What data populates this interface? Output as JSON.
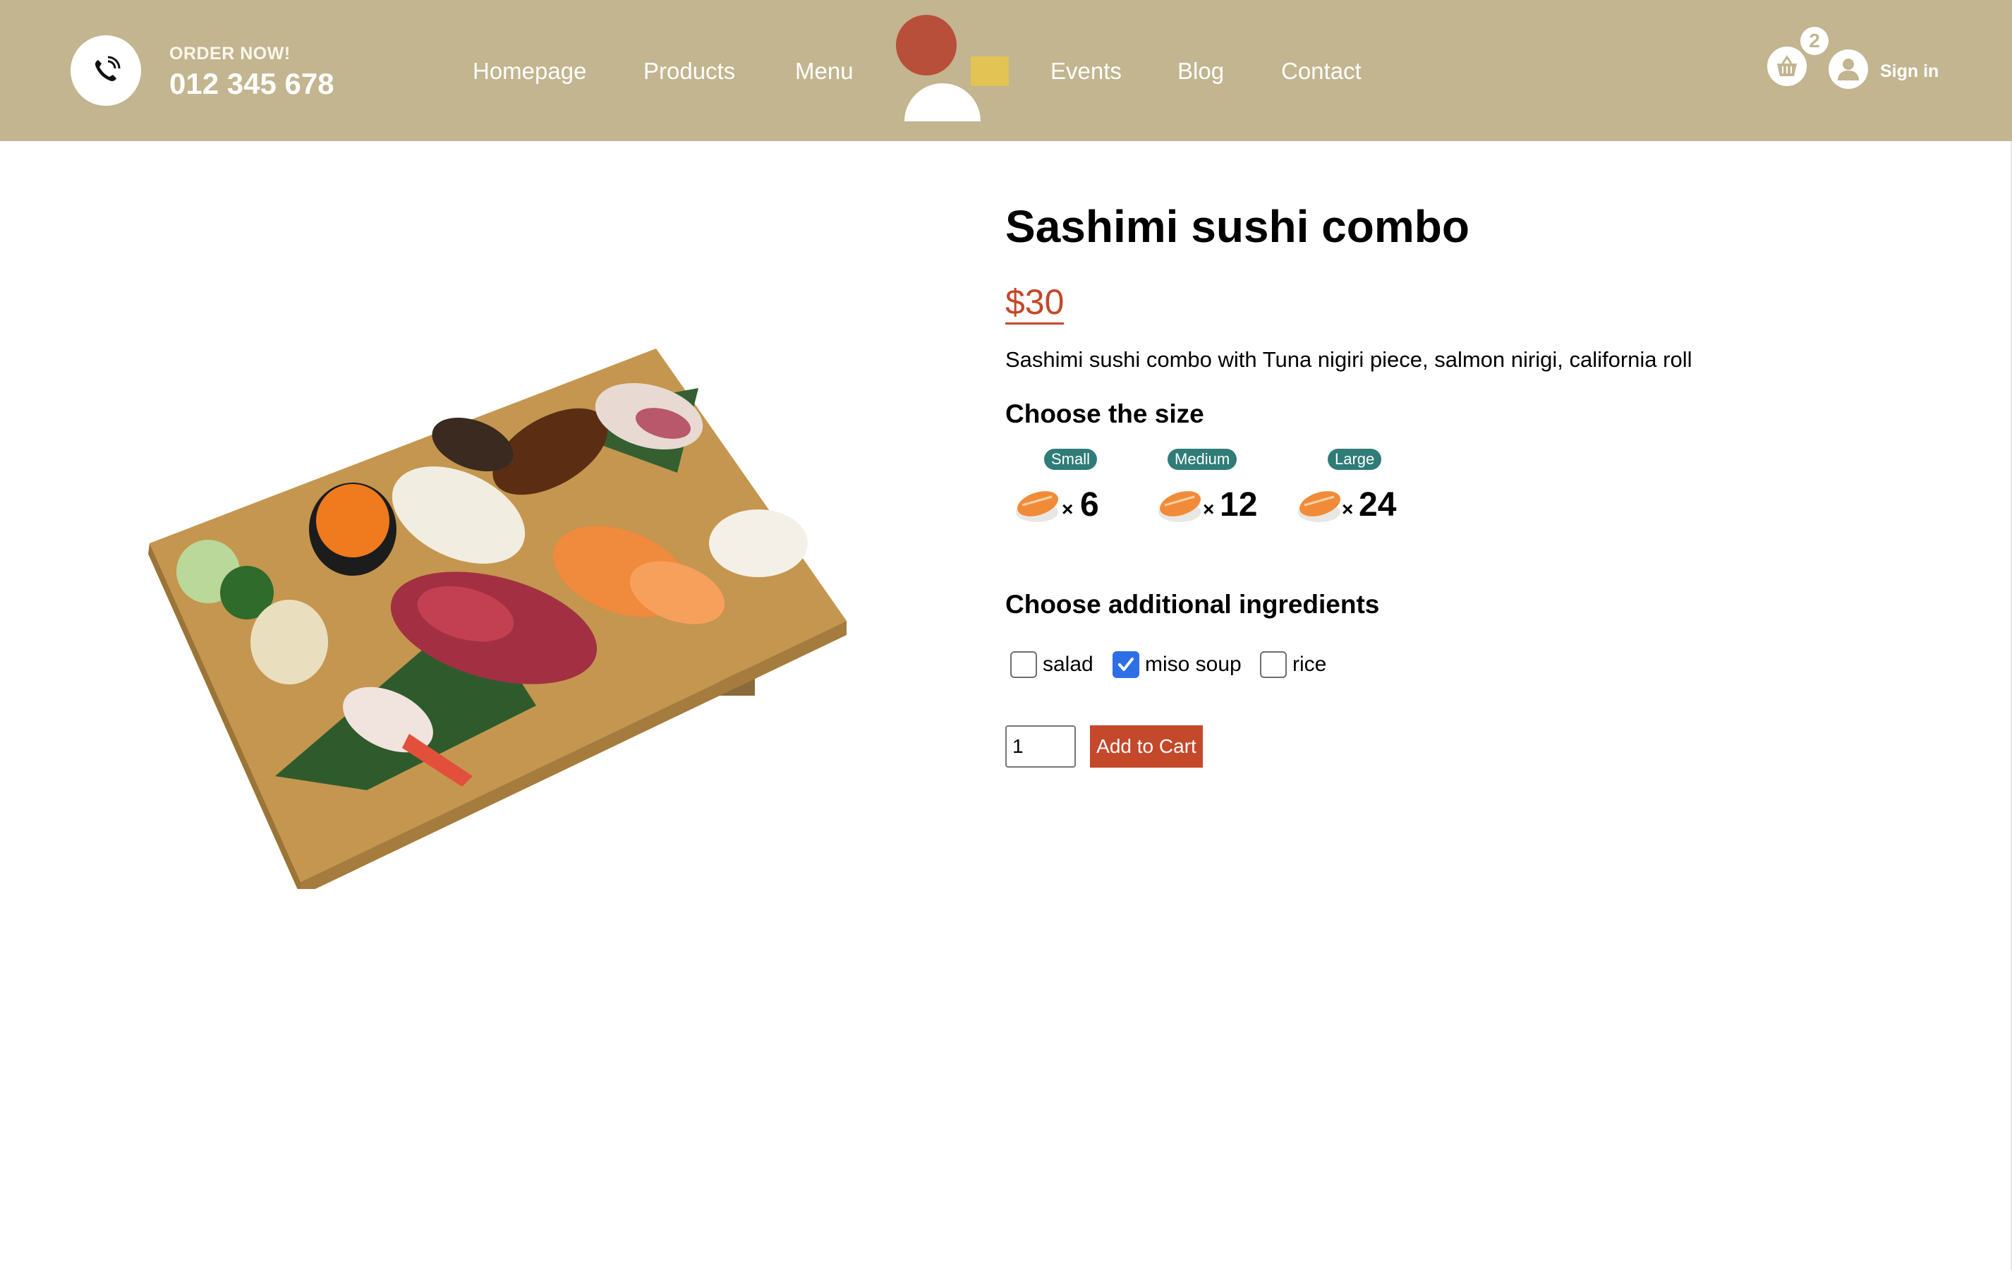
{
  "header": {
    "order_label": "ORDER NOW!",
    "phone": "012 345 678",
    "nav": [
      "Homepage",
      "Products",
      "Menu",
      "Events",
      "Blog",
      "Contact"
    ],
    "cart_count": "2",
    "signin": "Sign in",
    "icons": {
      "phone": "phone-icon",
      "cart": "basket-icon",
      "user": "user-icon"
    },
    "colors": {
      "header_bg": "#c2b58f",
      "logo_circle": "#b84f3a",
      "logo_square": "#e1c453"
    }
  },
  "product": {
    "title": "Sashimi sushi combo",
    "price": "$30",
    "description": "Sashimi sushi combo with Tuna nigiri piece, salmon nirigi, california roll",
    "size_heading": "Choose the size",
    "sizes": [
      {
        "label": "Small",
        "x": "×",
        "count": "6"
      },
      {
        "label": "Medium",
        "x": "×",
        "count": "12"
      },
      {
        "label": "Large",
        "x": "×",
        "count": "24"
      }
    ],
    "ingredients_heading": "Choose additional ingredients",
    "ingredients": [
      {
        "label": "salad",
        "checked": false
      },
      {
        "label": "miso soup",
        "checked": true
      },
      {
        "label": "rice",
        "checked": false
      }
    ],
    "quantity": "1",
    "add_to_cart": "Add to Cart",
    "colors": {
      "price": "#c4482a",
      "badge": "#2f7c78",
      "button": "#c4482a",
      "checkbox_checked": "#2f6fe6"
    }
  }
}
